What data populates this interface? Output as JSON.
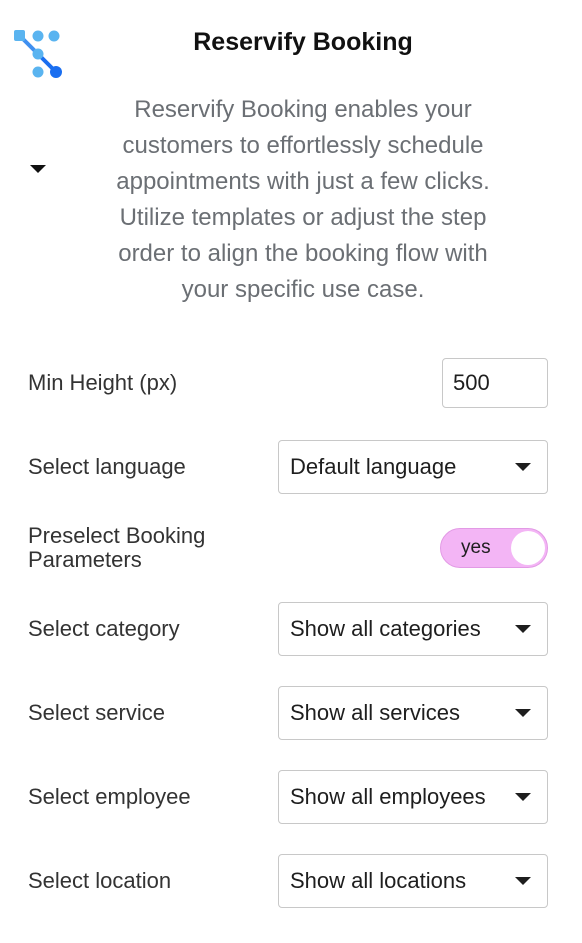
{
  "header": {
    "title": "Reservify Booking",
    "description": "Reservify Booking enables your customers to effortlessly schedule appointments with just a few clicks. Utilize templates or adjust the step order to align the booking flow with your specific use case."
  },
  "colors": {
    "logo_light": "#5ab4f0",
    "logo_dark": "#1a6ef0",
    "toggle_bg": "#f3b5f5",
    "description_text": "#6b6f74"
  },
  "settings": {
    "min_height": {
      "label": "Min Height (px)",
      "value": "500"
    },
    "language": {
      "label": "Select language",
      "value": "Default language"
    },
    "preselect": {
      "label": "Preselect Booking Parameters",
      "toggle_text": "yes",
      "enabled": true
    },
    "category": {
      "label": "Select category",
      "value": "Show all categories"
    },
    "service": {
      "label": "Select service",
      "value": "Show all services"
    },
    "employee": {
      "label": "Select employee",
      "value": "Show all employees"
    },
    "location": {
      "label": "Select location",
      "value": "Show all locations"
    }
  }
}
